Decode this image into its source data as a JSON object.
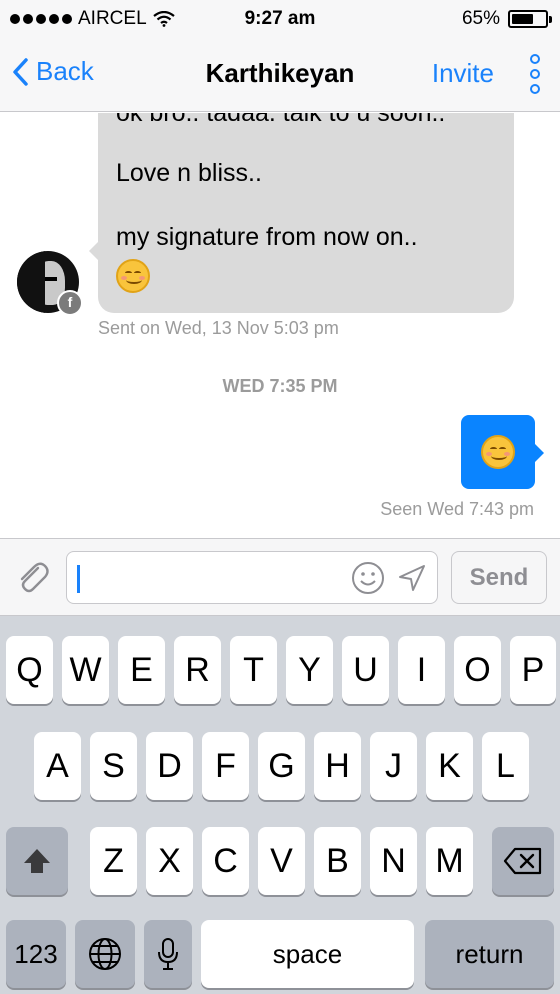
{
  "status_bar": {
    "carrier": "AIRCEL",
    "time": "9:27 am",
    "battery_percent": "65%",
    "battery_level": 0.65
  },
  "nav": {
    "back_label": "Back",
    "title": "Karthikeyan",
    "invite_label": "Invite"
  },
  "messages": {
    "incoming_lines": [
      "ok bro.. tadaa. talk to u soon..",
      "Love n bliss..",
      "my signature from now on.."
    ],
    "sent_meta": "Sent on Wed, 13 Nov 5:03 pm",
    "day_separator": "WED 7:35 PM",
    "seen_meta": "Seen Wed 7:43 pm"
  },
  "composer": {
    "input_value": "",
    "send_label": "Send"
  },
  "keyboard": {
    "row1": [
      "Q",
      "W",
      "E",
      "R",
      "T",
      "Y",
      "U",
      "I",
      "O",
      "P"
    ],
    "row2": [
      "A",
      "S",
      "D",
      "F",
      "G",
      "H",
      "J",
      "K",
      "L"
    ],
    "row3": [
      "Z",
      "X",
      "C",
      "V",
      "B",
      "N",
      "M"
    ],
    "numbers_label": "123",
    "space_label": "space",
    "return_label": "return"
  },
  "colors": {
    "accent": "#1a82fb",
    "outgoing_bubble": "#0a84ff",
    "incoming_bubble": "#dadada",
    "meta_text": "#9b9b9b"
  },
  "icons": [
    "wifi-icon",
    "battery-icon",
    "back-chevron-icon",
    "more-icon",
    "facebook-badge-icon",
    "paperclip-icon",
    "smiley-icon",
    "send-arrow-icon",
    "shift-icon",
    "backspace-icon",
    "globe-icon",
    "microphone-icon"
  ]
}
